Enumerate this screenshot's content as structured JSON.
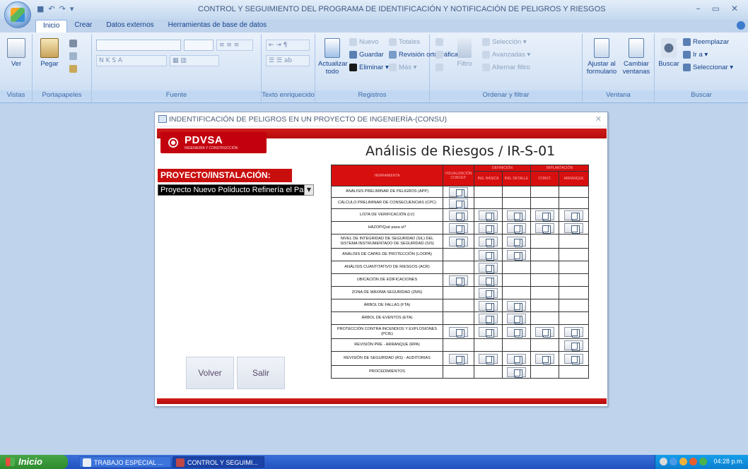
{
  "window": {
    "title": "CONTROL Y SEGUIMIENTO DEL PROGRAMA DE IDENTIFICACIÓN Y NOTIFICACIÓN DE PELIGROS Y RIESGOS",
    "controls": [
      "–",
      "▭",
      "✕"
    ]
  },
  "tabs": [
    "Inicio",
    "Crear",
    "Datos externos",
    "Herramientas de base de datos"
  ],
  "ribbon": {
    "groups": {
      "vistas": "Vistas",
      "portapapeles": "Portapapeles",
      "fuente": "Fuente",
      "texto": "Texto enriquecido",
      "registros": "Registros",
      "ordenar": "Ordenar y filtrar",
      "ventana": "Ventana",
      "buscar": "Buscar"
    },
    "ver": "Ver",
    "pegar": "Pegar",
    "actualizar": "Actualizar todo",
    "nuevo": "Nuevo",
    "guardar": "Guardar",
    "eliminar": "Eliminar",
    "totales": "Totales",
    "revision": "Revisión ortográfica",
    "mas": "Más",
    "filtro": "Filtro",
    "seleccion": "Selección",
    "avanzadas": "Avanzadas",
    "alternar": "Alternar filtro",
    "ajustar": "Ajustar al formulario",
    "cambiar": "Cambiar ventanas",
    "buscar_btn": "Buscar",
    "reemplazar": "Reemplazar",
    "ira": "Ir a",
    "seleccionar": "Seleccionar"
  },
  "form": {
    "title": "INDENTIFICACIÓN DE PELIGROS EN UN PROYECTO DE INGENIERÍA-(CONSU)",
    "logo_text": "PDVSA",
    "logo_sub": "INGENIERÍA Y CONSTRUCCIÓN",
    "heading": "Análisis de Riesgos / IR-S-01",
    "project_label": "PROYECTO/INSTALACIÓN:",
    "project_value": "Proyecto Nuevo Poliducto Refinería el Pa",
    "buttons": {
      "volver": "Volver",
      "salir": "Salir"
    },
    "table": {
      "col_title": "HERRAMIENTA",
      "group_def": "DEFINICIÓN",
      "group_impl": "IMPLANTACIÓN",
      "cols": [
        "VISUALIZACIÓN CONCEP.",
        "ING. BÁSICA",
        "ING. DETALLE",
        "CONST.",
        "ARRANQUE"
      ],
      "rows": [
        {
          "name": "ANÁLISIS PRELIMINAR DE PELIGROS (APP)",
          "cells": [
            1,
            0,
            0,
            0,
            0
          ]
        },
        {
          "name": "CÁLCULO PRELIMINAR DE CONSECUENCIAS (CPC)",
          "cells": [
            1,
            0,
            0,
            0,
            0
          ]
        },
        {
          "name": "LISTA DE VERIFICACIÓN (LV)",
          "cells": [
            1,
            1,
            1,
            1,
            1
          ]
        },
        {
          "name": "HAZOP/Qué pasa si?",
          "cells": [
            1,
            1,
            1,
            1,
            1
          ]
        },
        {
          "name": "NIVEL DE INTEGRIDAD DE SEGURIDAD (SIL) DEL SISTEMA INSTRUMENTADO DE SEGURIDAD (SIS)",
          "cells": [
            1,
            1,
            1,
            0,
            0
          ]
        },
        {
          "name": "ANÁLISIS DE CAPAS DE PROTECCIÓN (LOOPA)",
          "cells": [
            0,
            1,
            1,
            0,
            0
          ]
        },
        {
          "name": "ANÁLISIS CUANTITATIVO DE RIESGOS (ACR)",
          "cells": [
            0,
            1,
            0,
            0,
            0
          ]
        },
        {
          "name": "UBICACIÓN DE EDIFICACIONES",
          "cells": [
            1,
            1,
            0,
            0,
            0
          ]
        },
        {
          "name": "ZONA DE MÁXIMA SEGURIDAD (ZMS)",
          "cells": [
            0,
            1,
            0,
            0,
            0
          ]
        },
        {
          "name": "ÁRBOL DE FALLAS (FTA)",
          "cells": [
            0,
            1,
            1,
            0,
            0
          ]
        },
        {
          "name": "ÁRBOL DE EVENTOS (ETA)",
          "cells": [
            0,
            1,
            1,
            0,
            0
          ]
        },
        {
          "name": "PROTECCIÓN CONTRA INCENDIOS Y EXPLOSIONES (PCIE)",
          "cells": [
            1,
            1,
            1,
            1,
            1
          ]
        },
        {
          "name": "REVISIÓN PRE - ARRANQUE (RPA)",
          "cells": [
            0,
            0,
            0,
            0,
            1
          ]
        },
        {
          "name": "REVISIÓN DE SEGURIDAD (RS) - AUDITORIAS",
          "cells": [
            1,
            1,
            1,
            1,
            1
          ]
        },
        {
          "name": "PROCEDIMIENTOS",
          "cells": [
            0,
            0,
            1,
            0,
            0
          ]
        }
      ]
    }
  },
  "taskbar": {
    "start": "Inicio",
    "tasks": [
      "TRABAJO ESPECIAL ...",
      "CONTROL Y SEGUIMI..."
    ],
    "clock": "04:28 p.m."
  },
  "colors": {
    "pdvsa_red": "#c90e0e",
    "taskbar_blue": "#2152c0",
    "start_green": "#3a9a3a"
  }
}
